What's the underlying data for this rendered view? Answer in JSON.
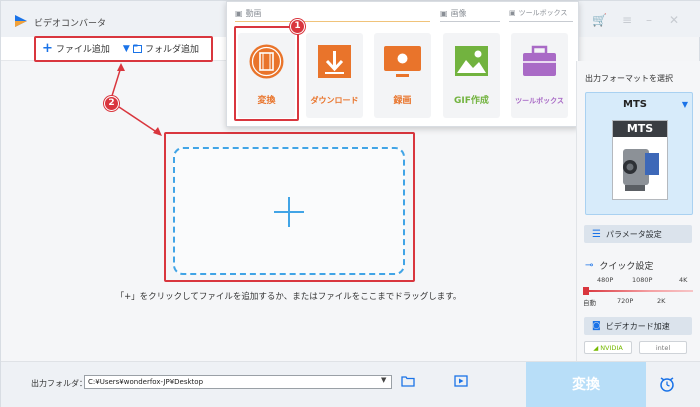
{
  "window": {
    "title": "ビデオコンバータ",
    "brand_color": "#1a73e8",
    "annotation_color": "#d9363e"
  },
  "toolbar": {
    "add_file_label": "ファイル追加",
    "add_folder_label": "フォルダ追加"
  },
  "popup": {
    "sections": [
      {
        "label": "動画",
        "icon": "film-icon"
      },
      {
        "label": "画像",
        "icon": "image-icon"
      },
      {
        "label": "ツールボックス",
        "icon": "toolbox-icon"
      }
    ],
    "tiles": [
      {
        "label": "変換",
        "color": "#e9742b",
        "icon": "convert-film-icon"
      },
      {
        "label": "ダウンロード",
        "color": "#e9742b",
        "icon": "download-icon"
      },
      {
        "label": "録画",
        "color": "#e9742b",
        "icon": "screen-record-icon"
      },
      {
        "label": "GIF作成",
        "color": "#72b33f",
        "icon": "gif-image-icon"
      },
      {
        "label": "ツールボックス",
        "color": "#a96ac6",
        "icon": "toolbox-icon"
      }
    ]
  },
  "annotations": {
    "badge1": "1",
    "badge2": "2"
  },
  "main": {
    "hint": "「+」をクリックしてファイルを追加するか、またはファイルをここまでドラッグします。"
  },
  "right_panel": {
    "title": "出力フォーマットを選択",
    "format": "MTS",
    "format_icon_text": "MTS",
    "param_label": "パラメータ設定",
    "quick_label": "クイック設定",
    "ticks_top": [
      "480P",
      "1080P",
      "4K"
    ],
    "ticks_bottom": [
      "自動",
      "720P",
      "2K"
    ],
    "gpu_label": "ビデオカード加速",
    "gpu_options": [
      "NVIDIA",
      "intel"
    ]
  },
  "bottom": {
    "output_label": "出力フォルダ：",
    "output_path": "C:¥Users¥wonderfox-JP¥Desktop",
    "convert_label": "変換"
  }
}
